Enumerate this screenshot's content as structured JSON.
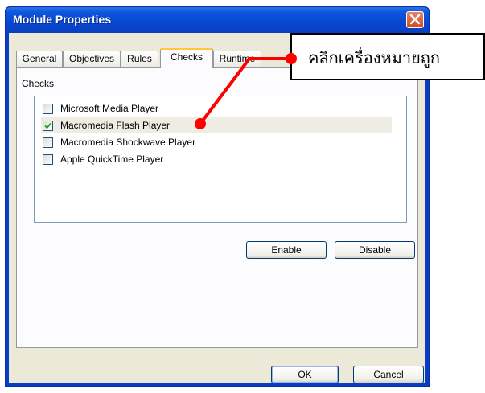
{
  "window": {
    "title": "Module Properties"
  },
  "tabs": [
    {
      "label": "General"
    },
    {
      "label": "Objectives"
    },
    {
      "label": "Rules"
    },
    {
      "label": "Checks",
      "active": true
    },
    {
      "label": "Runtime"
    }
  ],
  "checks": {
    "group_label": "Checks",
    "items": [
      {
        "label": "Microsoft Media Player",
        "checked": false
      },
      {
        "label": "Macromedia Flash Player",
        "checked": true
      },
      {
        "label": "Macromedia Shockwave Player",
        "checked": false
      },
      {
        "label": "Apple QuickTime Player",
        "checked": false
      }
    ],
    "enable_label": "Enable",
    "disable_label": "Disable"
  },
  "footer": {
    "ok_label": "OK",
    "cancel_label": "Cancel"
  },
  "annotation": {
    "text": "คลิกเครื่องหมายถูก",
    "color": "#ff0000"
  },
  "colors": {
    "title_bar": "#0a3ec8",
    "client_bg": "#ece9d8",
    "active_tab_accent": "#ffc73c"
  },
  "icons": {
    "close": "close-icon",
    "check": "checkmark-icon"
  }
}
